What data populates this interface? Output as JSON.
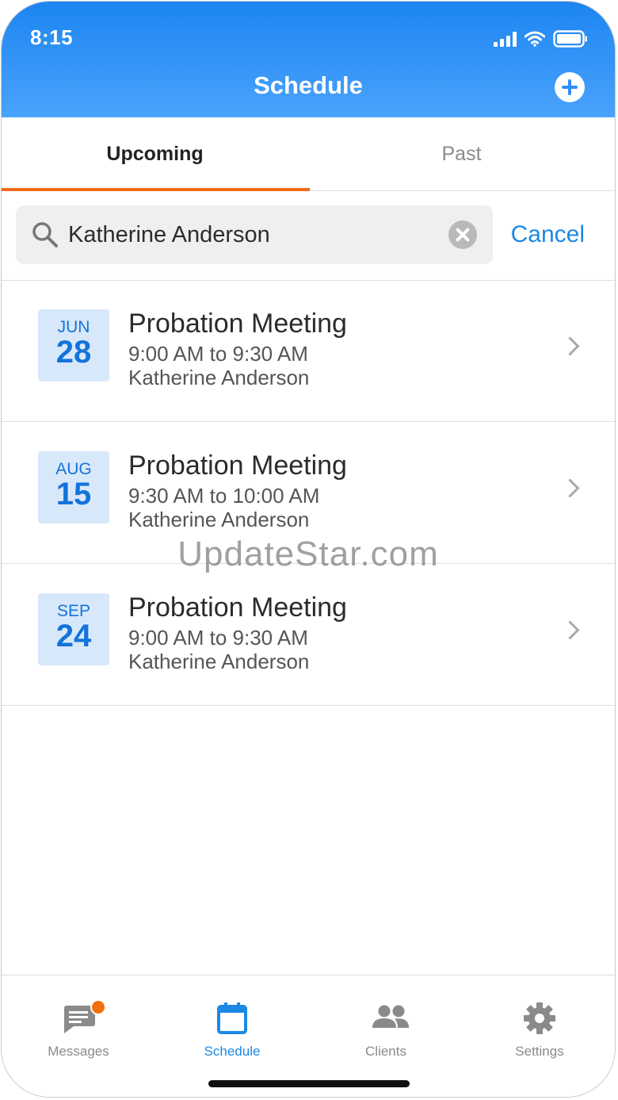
{
  "status_bar": {
    "time": "8:15"
  },
  "header": {
    "title": "Schedule",
    "add_icon": "add-circle-icon"
  },
  "tabs": [
    {
      "label": "Upcoming",
      "active": true
    },
    {
      "label": "Past",
      "active": false
    }
  ],
  "search": {
    "value": "Katherine Anderson",
    "cancel_label": "Cancel"
  },
  "appointments": [
    {
      "month": "JUN",
      "day": "28",
      "title": "Probation Meeting",
      "time": "9:00 AM to 9:30 AM",
      "client": "Katherine Anderson"
    },
    {
      "month": "AUG",
      "day": "15",
      "title": "Probation Meeting",
      "time": "9:30 AM to 10:00 AM",
      "client": "Katherine Anderson"
    },
    {
      "month": "SEP",
      "day": "24",
      "title": "Probation Meeting",
      "time": "9:00 AM to 9:30 AM",
      "client": "Katherine Anderson"
    }
  ],
  "watermark": "UpdateStar.com",
  "tab_bar": [
    {
      "label": "Messages",
      "icon": "messages-icon",
      "active": false,
      "has_notification": true
    },
    {
      "label": "Schedule",
      "icon": "calendar-icon",
      "active": true
    },
    {
      "label": "Clients",
      "icon": "clients-icon",
      "active": false
    },
    {
      "label": "Settings",
      "icon": "gear-icon",
      "active": false
    }
  ],
  "colors": {
    "header": "#2a8ff4",
    "accent": "#1e88e5",
    "tab_underline": "#ef6c1a",
    "date_badge_bg": "#d8e8fb",
    "notification": "#f0700f"
  }
}
